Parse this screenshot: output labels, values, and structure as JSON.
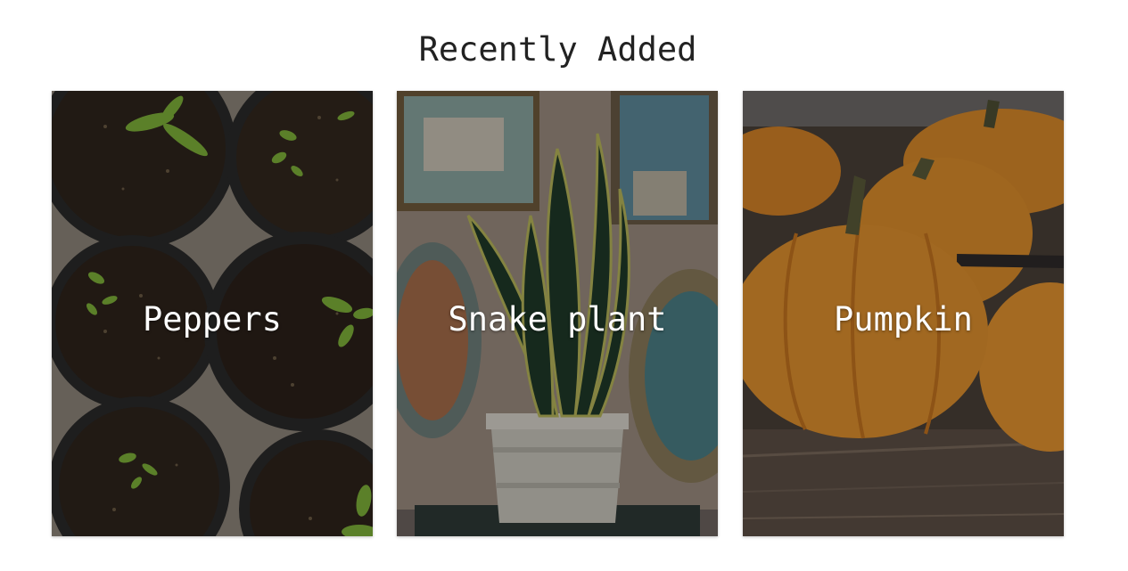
{
  "section": {
    "title": "Recently Added"
  },
  "cards": [
    {
      "label": "Peppers",
      "image": "seedling-pots-photo"
    },
    {
      "label": "Snake plant",
      "image": "potted-snake-plant-photo"
    },
    {
      "label": "Pumpkin",
      "image": "pumpkins-photo"
    }
  ],
  "colors": {
    "title_text": "#222222",
    "card_label_text": "#ffffff",
    "page_background": "#ffffff"
  }
}
